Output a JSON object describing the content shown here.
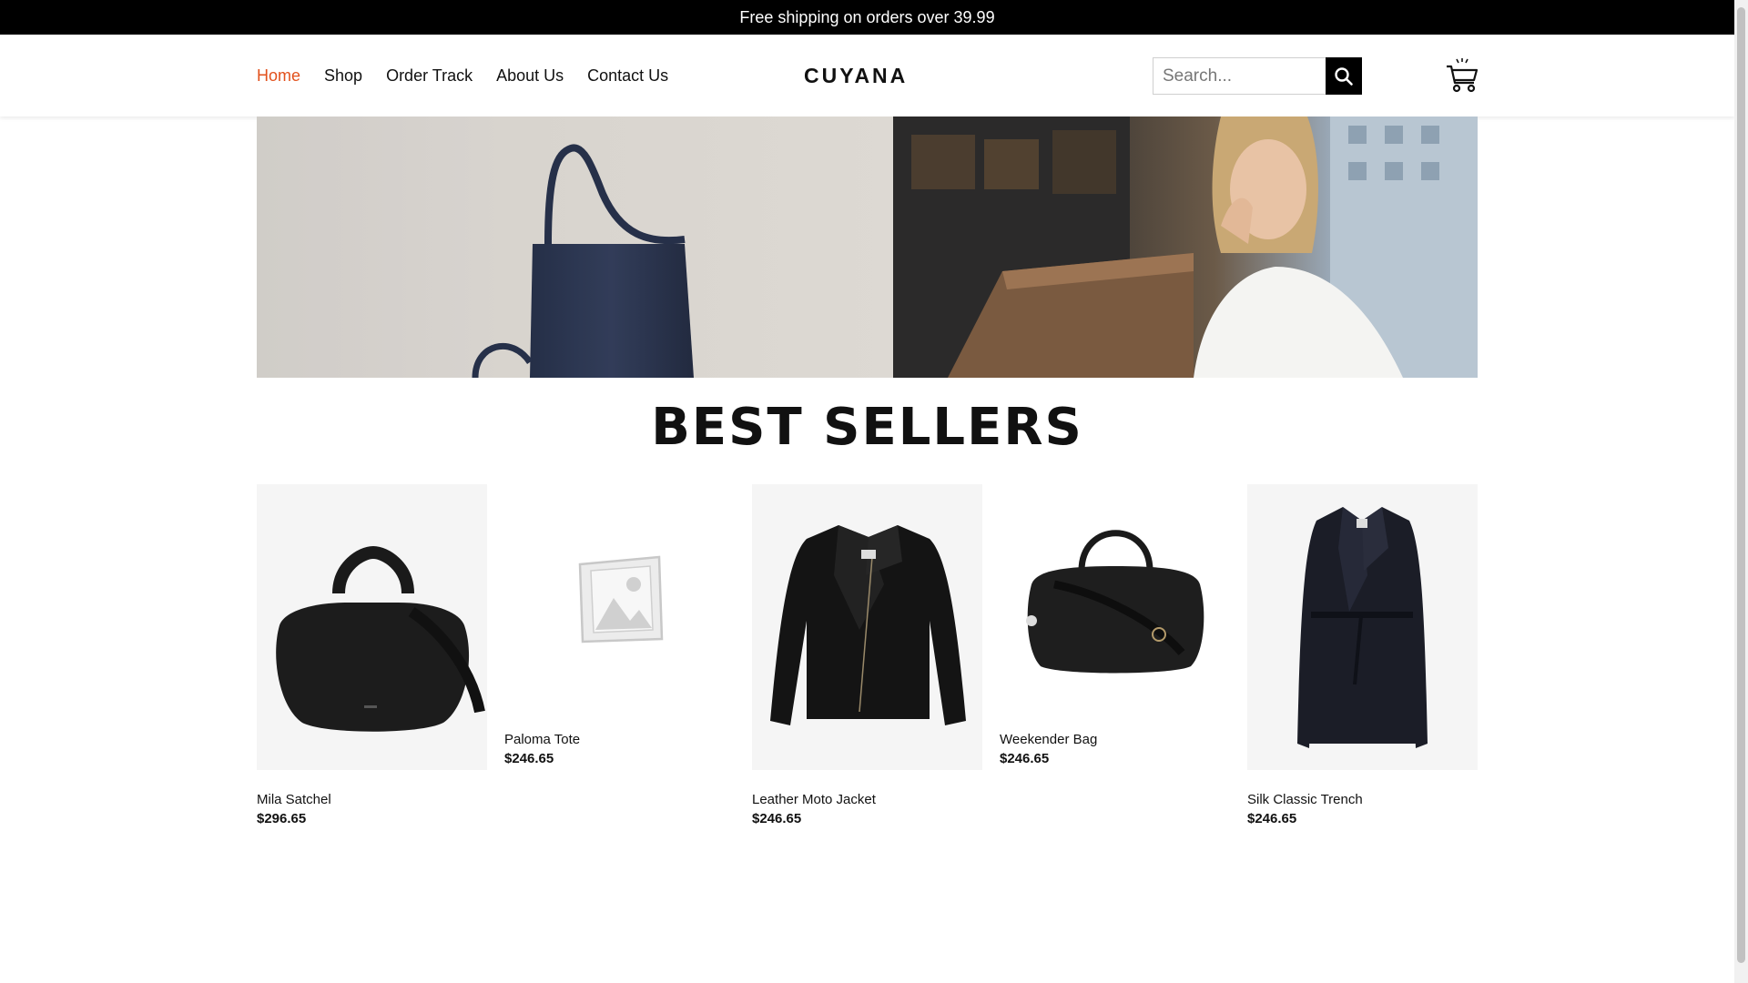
{
  "announcement": "Free shipping on orders over 39.99",
  "nav": {
    "items": [
      {
        "label": "Home",
        "active": true
      },
      {
        "label": "Shop",
        "active": false
      },
      {
        "label": "Order Track",
        "active": false
      },
      {
        "label": "About Us",
        "active": false
      },
      {
        "label": "Contact Us",
        "active": false
      }
    ]
  },
  "brand": "CUYANA",
  "search": {
    "placeholder": "Search...",
    "icon": "search-icon"
  },
  "cart": {
    "icon": "shopping-cart-icon"
  },
  "section_title": "BEST SELLERS",
  "products": [
    {
      "name": "Mila Satchel",
      "price": "$296.65"
    },
    {
      "name": "Paloma Tote",
      "price": "$246.65"
    },
    {
      "name": "Leather Moto Jacket",
      "price": "$246.65"
    },
    {
      "name": "Weekender Bag",
      "price": "$246.65"
    },
    {
      "name": "Silk Classic Trench",
      "price": "$246.65"
    }
  ],
  "colors": {
    "accent": "#e2511c",
    "topbar": "#000000"
  }
}
